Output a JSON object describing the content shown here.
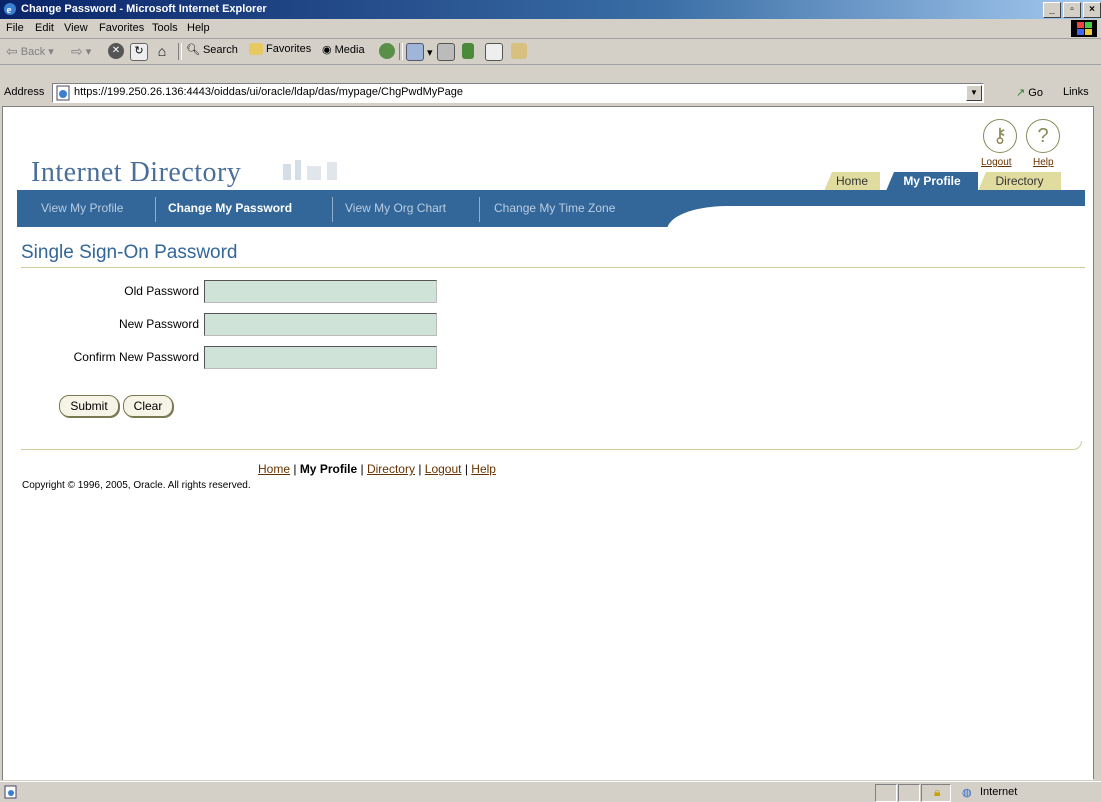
{
  "window": {
    "title": "Change Password - Microsoft Internet Explorer"
  },
  "menu": [
    "File",
    "Edit",
    "View",
    "Favorites",
    "Tools",
    "Help"
  ],
  "toolbar": {
    "back": "Back",
    "search": "Search",
    "favorites": "Favorites",
    "media": "Media"
  },
  "address": {
    "label": "Address",
    "url": "https://199.250.26.136:4443/oiddas/ui/oracle/ldap/das/mypage/ChgPwdMyPage",
    "go": "Go",
    "links": "Links"
  },
  "brand": {
    "name": "Internet Directory"
  },
  "global": {
    "logout": "Logout",
    "help": "Help"
  },
  "tabs": {
    "home": "Home",
    "my_profile": "My Profile",
    "directory": "Directory",
    "active": "My Profile"
  },
  "subtabs": {
    "view_profile": "View My Profile",
    "change_password": "Change My Password",
    "org_chart": "View My Org Chart",
    "time_zone": "Change My Time Zone",
    "active": "Change My Password"
  },
  "page": {
    "heading": "Single Sign-On Password"
  },
  "form": {
    "old_password_label": "Old Password",
    "new_password_label": "New Password",
    "confirm_password_label": "Confirm New Password",
    "old_password_value": "",
    "new_password_value": "",
    "confirm_password_value": "",
    "submit": "Submit",
    "clear": "Clear"
  },
  "footer": {
    "home": "Home",
    "my_profile": "My Profile",
    "directory": "Directory",
    "logout": "Logout",
    "help": "Help",
    "copyright": "Copyright © 1996, 2005, Oracle. All rights reserved."
  },
  "status": {
    "zone": "Internet"
  },
  "colors": {
    "nav_blue": "#336699",
    "tab_tan": "#e0dca0",
    "input_fill": "#cfe3d9",
    "link": "#663300"
  }
}
